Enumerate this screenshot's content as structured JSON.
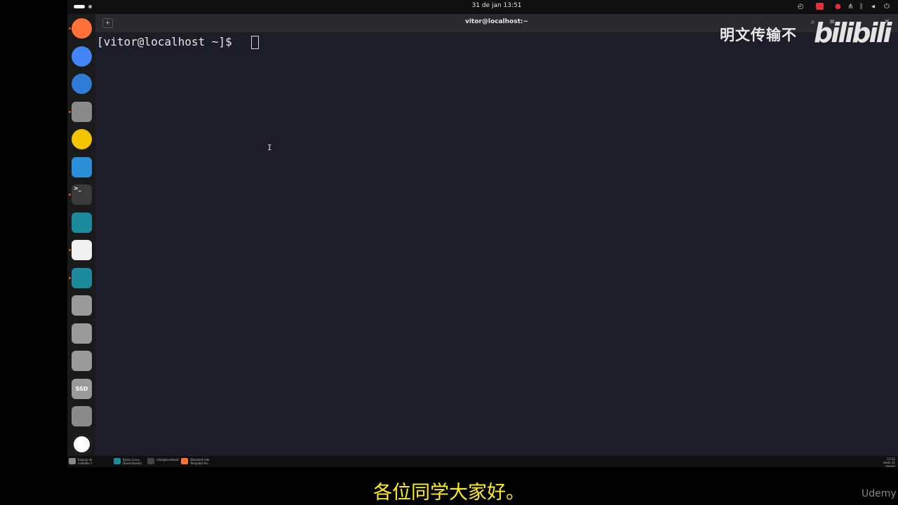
{
  "topbar": {
    "clock": "31 de jan  13:51"
  },
  "dock": {
    "items": [
      {
        "name": "firefox",
        "icon": "firefox-icon",
        "color": "#ff7139",
        "running": true
      },
      {
        "name": "chrome",
        "icon": "chrome-icon",
        "color": "#4285f4",
        "running": false
      },
      {
        "name": "thunderbird",
        "icon": "thunderbird-icon",
        "color": "#2f7bd6",
        "running": false
      },
      {
        "name": "files",
        "icon": "folder-icon",
        "color": "#8a8a8a",
        "running": true
      },
      {
        "name": "rhythmbox",
        "icon": "speaker-icon",
        "color": "#f5c400",
        "running": false
      },
      {
        "name": "writer",
        "icon": "document-icon",
        "color": "#2a8fd6",
        "running": false
      },
      {
        "name": "terminal",
        "icon": "terminal-icon",
        "color": "#3a3a3a",
        "running": true
      },
      {
        "name": "virtualbox",
        "icon": "virtualbox-icon",
        "color": "#1b8a9a",
        "running": false
      },
      {
        "name": "text-editor",
        "icon": "pencil-icon",
        "color": "#f0f0f0",
        "running": true
      },
      {
        "name": "virtualbox-2",
        "icon": "virtualbox-icon",
        "color": "#1b8a9a",
        "running": true
      },
      {
        "name": "disk-1",
        "icon": "disk-icon",
        "color": "#9a9a9a",
        "running": false
      },
      {
        "name": "disk-2",
        "icon": "disk-icon",
        "color": "#9a9a9a",
        "running": false
      },
      {
        "name": "disk-3",
        "icon": "disk-icon",
        "color": "#9a9a9a",
        "running": false
      },
      {
        "name": "ssd",
        "icon": "ssd-icon",
        "color": "#9a9a9a",
        "running": false,
        "label": "SSD"
      },
      {
        "name": "trash",
        "icon": "trash-icon",
        "color": "#8a8a8a",
        "running": false
      },
      {
        "name": "show-apps",
        "icon": "ubuntu-logo-icon",
        "color": "#ffffff",
        "running": false
      }
    ]
  },
  "terminal": {
    "title": "vitor@localhost:~",
    "prompt": "[vitor@localhost ~]$ "
  },
  "taskbar": {
    "items": [
      {
        "label": "Espaço de trabalho 1",
        "icon": "workspace-icon"
      },
      {
        "label": "Rocky Linux [Executando]",
        "icon": "virtualbox-icon"
      },
      {
        "label": "vitor@localhost:~",
        "icon": "terminal-icon"
      },
      {
        "label": "Standard-rule Template-for...",
        "icon": "firefox-icon"
      }
    ],
    "clock": "13:51",
    "date": "sexta 31 janeiro"
  },
  "overlay": {
    "watermark": "明文传输不",
    "logo": "bilibili",
    "subtitle": "各位同学大家好。",
    "brand": "Udemy"
  }
}
